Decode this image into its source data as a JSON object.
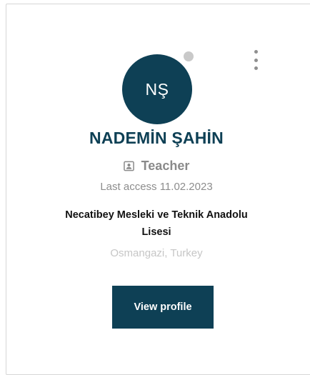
{
  "card": {
    "avatar_initials": "NŞ",
    "status": "offline",
    "name": "NADEMİN ŞAHİN",
    "role": "Teacher",
    "role_icon": "id-badge-icon",
    "menu_icon": "kebab-menu-icon",
    "last_access": "Last access 11.02.2023",
    "school_line1": "Necatibey Mesleki ve Teknik Anadolu",
    "school_line2": "Lisesi",
    "location": "Osmangazi, Turkey",
    "view_profile_label": "View profile"
  },
  "colors": {
    "primary": "#0e4055",
    "status_offline": "#c9c9c9",
    "muted_text": "#8a8a8a",
    "light_text": "#c6c6c6"
  }
}
